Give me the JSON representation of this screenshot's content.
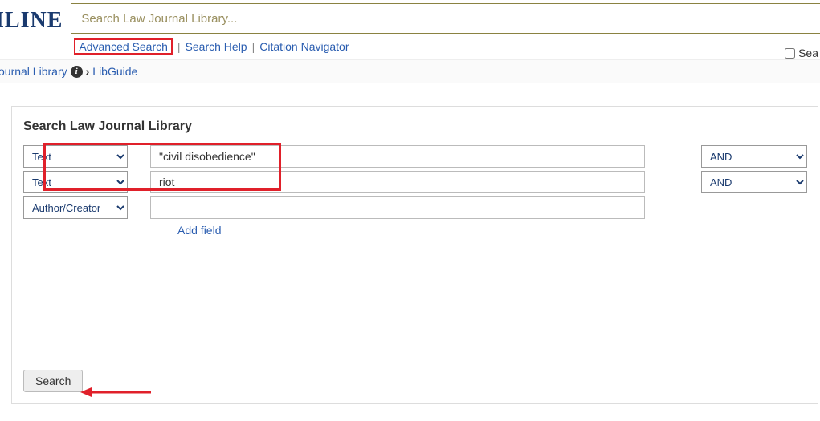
{
  "header": {
    "logo_fragment": "ILINE",
    "search_placeholder": "Search Law Journal Library...",
    "links": {
      "advanced_search": "Advanced Search",
      "search_help": "Search Help",
      "citation_navigator": "Citation Navigator"
    },
    "sea_label": "Sea"
  },
  "breadcrumb": {
    "journal_library": "ournal Library",
    "libguide": "LibGuide"
  },
  "panel": {
    "title": "Search Law Journal Library",
    "rows": [
      {
        "field": "Text",
        "term": "\"civil disobedience\"",
        "bool": "AND"
      },
      {
        "field": "Text",
        "term": "riot",
        "bool": "AND"
      },
      {
        "field": "Author/Creator",
        "term": "",
        "bool": ""
      }
    ],
    "add_field": "Add field",
    "search_button": "Search"
  }
}
